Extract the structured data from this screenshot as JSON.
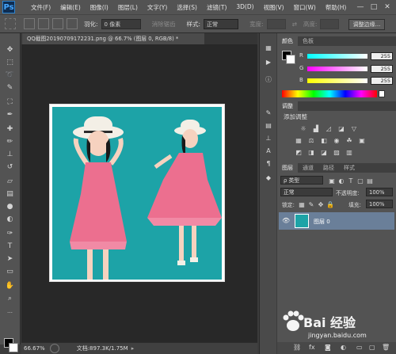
{
  "app": {
    "logo": "Ps"
  },
  "menu": [
    "文件(F)",
    "编辑(E)",
    "图像(I)",
    "图层(L)",
    "文字(Y)",
    "选择(S)",
    "滤镜(T)",
    "3D(D)",
    "视图(V)",
    "窗口(W)",
    "帮助(H)"
  ],
  "window_controls": [
    "—",
    "□",
    "✕"
  ],
  "options": {
    "feather_label": "羽化:",
    "feather_value": "0 像素",
    "antialias_label": "消除锯齿",
    "style_label": "样式:",
    "style_value": "正常",
    "width_label": "宽度:",
    "height_label": "高度:",
    "refine_label": "调整边缘..."
  },
  "document": {
    "tab_title": "QQ截图20190709172231.png @ 66.7% (图层 0, RGB/8) *",
    "zoom": "66.67%",
    "doc_info": "文档:897.3K/1.75M"
  },
  "color_panel": {
    "tabs": [
      "颜色",
      "色板"
    ],
    "rows": [
      {
        "label": "R",
        "value": "255"
      },
      {
        "label": "G",
        "value": "255"
      },
      {
        "label": "B",
        "value": "255"
      }
    ]
  },
  "adjust_panel": {
    "tab": "调整",
    "title": "添加调整"
  },
  "layers_panel": {
    "tabs": [
      "图层",
      "通道",
      "路径",
      "样式"
    ],
    "kind_value": "ρ 类型",
    "blend_mode": "正常",
    "opacity_label": "不透明度:",
    "opacity_value": "100%",
    "lock_label": "锁定:",
    "fill_label": "填充:",
    "fill_value": "100%",
    "layer_name": "图层 0"
  },
  "watermark": {
    "text": "Bai 经验",
    "url": "jingyan.baidu.com"
  },
  "colors": {
    "accent": "#46a7ff",
    "canvas_teal": "#1da3a7",
    "dress_pink": "#ec6f8f",
    "layer_selected": "#6a7f99"
  }
}
